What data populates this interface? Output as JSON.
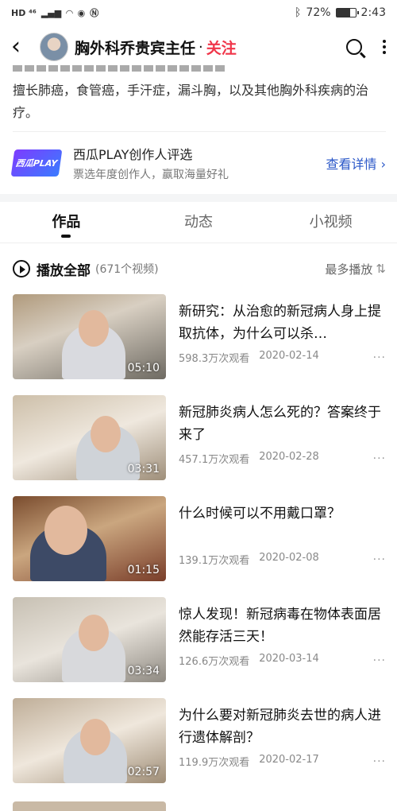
{
  "status_bar": {
    "left_label": "HD ⁴⁶",
    "battery": "72%",
    "battery_level": 0.72,
    "time": "2:43"
  },
  "header": {
    "title": "胸外科乔贵宾主任",
    "separator": "·",
    "follow": "关注",
    "follow_color": "#f0364a"
  },
  "profile": {
    "bio": "擅长肺癌，食管癌，手汗症，漏斗胸，以及其他胸外科疾病的治疗。"
  },
  "promo": {
    "logo_text": "西瓜PLAY",
    "title": "西瓜PLAY创作人评选",
    "subtitle": "票选年度创作人，赢取海量好礼",
    "link": "查看详情 ›",
    "link_color": "#2a57c8"
  },
  "tabs": [
    {
      "label": "作品",
      "active": true
    },
    {
      "label": "动态",
      "active": false
    },
    {
      "label": "小视频",
      "active": false
    }
  ],
  "list_header": {
    "play_all": "播放全部",
    "count": "(671个视频)",
    "sort": "最多播放",
    "sort_icon": "⇅"
  },
  "videos": [
    {
      "title": "新研究：从治愈的新冠病人身上提取抗体，为什么可以杀…",
      "duration": "05:10",
      "views": "598.3万次观看",
      "date": "2020-02-14",
      "more": "···"
    },
    {
      "title": "新冠肺炎病人怎么死的？答案终于来了",
      "duration": "03:31",
      "views": "457.1万次观看",
      "date": "2020-02-28",
      "more": "···"
    },
    {
      "title": "什么时候可以不用戴口罩？",
      "duration": "01:15",
      "views": "139.1万次观看",
      "date": "2020-02-08",
      "more": "···"
    },
    {
      "title": "惊人发现！新冠病毒在物体表面居然能存活三天！",
      "duration": "03:34",
      "views": "126.6万次观看",
      "date": "2020-03-14",
      "more": "···"
    },
    {
      "title": "为什么要对新冠肺炎去世的病人进行遗体解剖？",
      "duration": "02:57",
      "views": "119.9万次观看",
      "date": "2020-02-17",
      "more": "···"
    }
  ]
}
